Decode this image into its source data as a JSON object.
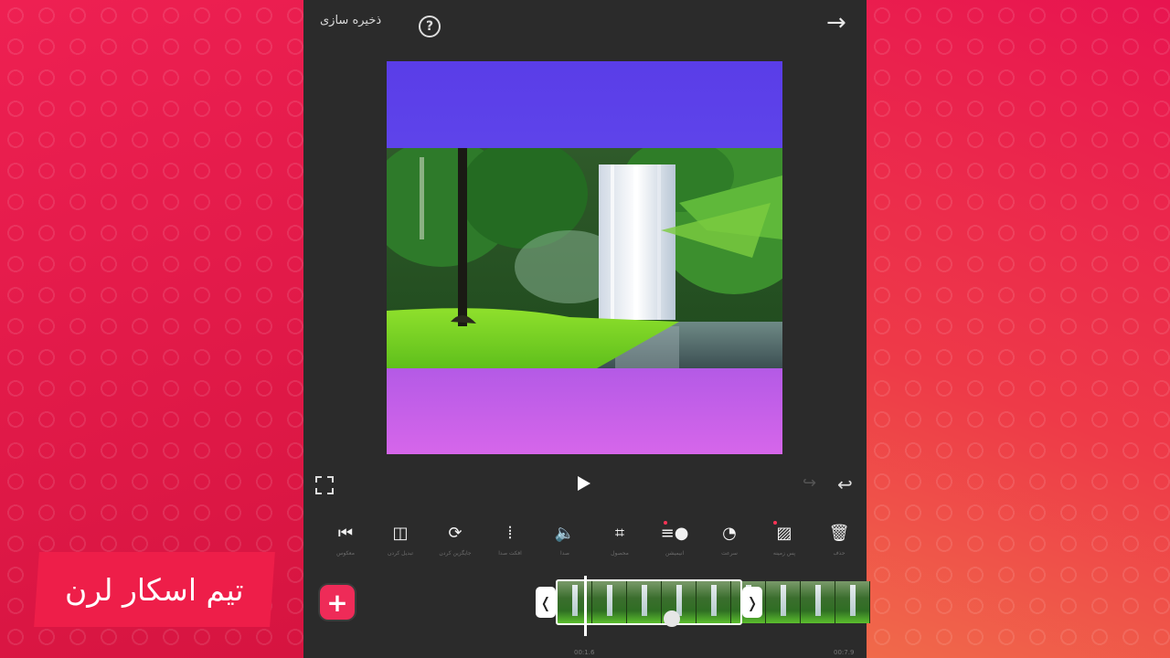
{
  "header": {
    "save_label": "ذخیره سازی",
    "help_icon": "help-circle-icon",
    "next_icon": "arrow-right-icon"
  },
  "preview": {
    "top_band_color": "#5a3de8",
    "bottom_band_color": "#c862e8"
  },
  "playback": {
    "fullscreen_icon": "fullscreen-icon",
    "play_icon": "play-icon",
    "redo_icon": "redo-icon",
    "undo_icon": "undo-icon"
  },
  "toolbar": {
    "items": [
      {
        "label": "معکوس",
        "icon": "rewind-icon",
        "glyph": "⏮",
        "badge": false
      },
      {
        "label": "تبدیل کردن",
        "icon": "split-view-icon",
        "glyph": "◫",
        "badge": false
      },
      {
        "label": "جایگزین کردن",
        "icon": "replace-icon",
        "glyph": "⟳",
        "badge": false
      },
      {
        "label": "افکت صدا",
        "icon": "audio-wave-icon",
        "glyph": "⦙",
        "badge": false
      },
      {
        "label": "صدا",
        "icon": "volume-icon",
        "glyph": "🔈",
        "badge": false
      },
      {
        "label": "محصول",
        "icon": "crop-icon",
        "glyph": "⌗",
        "badge": false
      },
      {
        "label": "انیمیشن",
        "icon": "animation-icon",
        "glyph": "≡●",
        "badge": true
      },
      {
        "label": "سرعت",
        "icon": "speed-icon",
        "glyph": "◔",
        "badge": false
      },
      {
        "label": "پس زمینه",
        "icon": "background-icon",
        "glyph": "▨",
        "badge": true
      },
      {
        "label": "حذف",
        "icon": "trash-icon",
        "glyph": "🗑",
        "badge": false
      }
    ]
  },
  "timeline": {
    "add_icon": "plus-icon",
    "add_glyph": "+",
    "handle_left_glyph": "❬",
    "handle_right_glyph": "❭",
    "current_time": "00:1.6",
    "end_time": "00:7.9"
  },
  "colors": {
    "accent": "#ee2b58",
    "panel": "#2b2b2b",
    "watermark_bg": "#ee1e49"
  },
  "watermark": {
    "text": "تیم اسکار لرن"
  }
}
